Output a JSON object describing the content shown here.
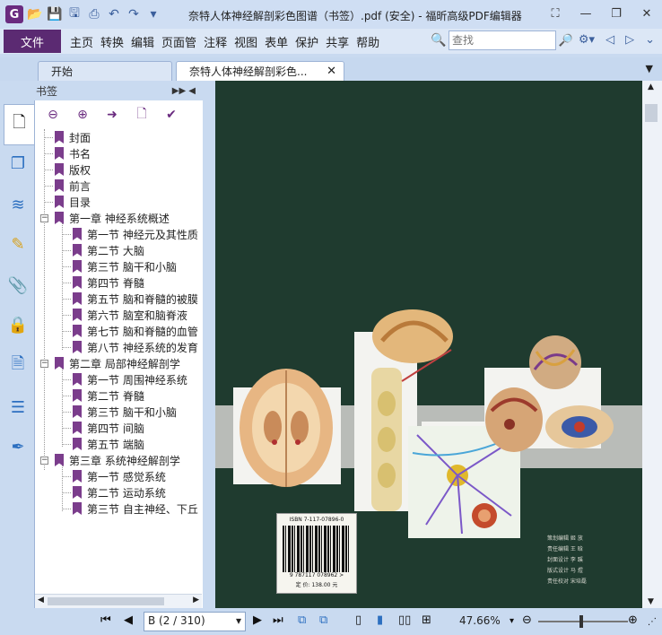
{
  "window": {
    "title": "奈特人体神经解剖彩色图谱（书签）.pdf (安全) - 福昕高级PDF编辑器"
  },
  "menu": {
    "file": "文件",
    "items": [
      "主页",
      "转换",
      "编辑",
      "页面管",
      "注释",
      "视图",
      "表单",
      "保护",
      "共享",
      "帮助"
    ],
    "search_placeholder": "查找"
  },
  "tabs": [
    {
      "label": "开始",
      "active": false
    },
    {
      "label": "奈特人体神经解剖彩色...",
      "active": true
    }
  ],
  "panel": {
    "title": "书签"
  },
  "bookmarks": [
    {
      "label": "封面",
      "level": 0
    },
    {
      "label": "书名",
      "level": 0
    },
    {
      "label": "版权",
      "level": 0
    },
    {
      "label": "前言",
      "level": 0
    },
    {
      "label": "目录",
      "level": 0
    },
    {
      "label": "第一章 神经系统概述",
      "level": 0,
      "expanded": true
    },
    {
      "label": "第一节 神经元及其性质",
      "level": 1
    },
    {
      "label": "第二节 大脑",
      "level": 1
    },
    {
      "label": "第三节 脑干和小脑",
      "level": 1
    },
    {
      "label": "第四节 脊髓",
      "level": 1
    },
    {
      "label": "第五节 脑和脊髓的被膜",
      "level": 1
    },
    {
      "label": "第六节 脑室和脑脊液",
      "level": 1
    },
    {
      "label": "第七节 脑和脊髓的血管",
      "level": 1
    },
    {
      "label": "第八节 神经系统的发育",
      "level": 1
    },
    {
      "label": "第二章 局部神经解剖学",
      "level": 0,
      "expanded": true
    },
    {
      "label": "第一节 周围神经系统",
      "level": 1
    },
    {
      "label": "第二节 脊髓",
      "level": 1
    },
    {
      "label": "第三节 脑干和小脑",
      "level": 1
    },
    {
      "label": "第四节 间脑",
      "level": 1
    },
    {
      "label": "第五节 端脑",
      "level": 1
    },
    {
      "label": "第三章 系统神经解剖学",
      "level": 0,
      "expanded": true
    },
    {
      "label": "第一节 感觉系统",
      "level": 1
    },
    {
      "label": "第二节 运动系统",
      "level": 1
    },
    {
      "label": "第三节 自主神经、下丘",
      "level": 1
    }
  ],
  "page": {
    "isbn": "ISBN 7-117-07896-0",
    "barcode_number": "9 787117 078962 >",
    "price": "定 价: 138.00 元",
    "credits": [
      "策划编辑  姬  放",
      "责任编辑  王  晗",
      "封面设计  李  蹊",
      "版式设计  马  煜",
      "责任校对  宋培磊"
    ]
  },
  "status": {
    "page_indicator": "B (2 / 310)",
    "zoom": "47.66%",
    "zoom_fraction": 0.4766
  },
  "colors": {
    "accent": "#5b2a72",
    "bookmark_flag": "#7b3d8c",
    "cover_bg": "#1f3b2f"
  }
}
